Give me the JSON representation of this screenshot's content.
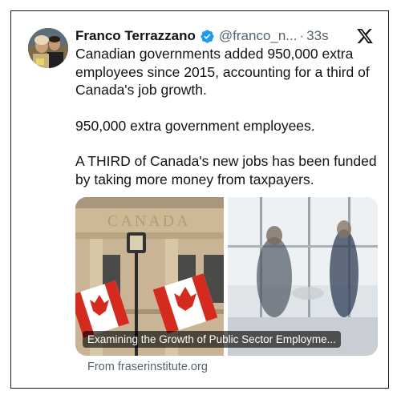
{
  "tweet": {
    "author_name": "Franco Terrazzano",
    "handle": "@franco_n...",
    "separator": "·",
    "time": "33s",
    "paragraphs": [
      "Canadian governments added 950,000 extra employees since 2015, accounting for a third of Canada's job growth.",
      "950,000 extra government employees.",
      "A THIRD of Canada's new jobs has been funded by taking more money from taxpayers."
    ]
  },
  "card": {
    "building_sign": "CANADA",
    "title": "Examining the Growth of Public Sector Employme...",
    "source": "From fraserinstitute.org"
  },
  "icons": {
    "verified": "verified-badge-icon",
    "x_logo": "x-logo-icon"
  },
  "colors": {
    "verified_blue": "#1d9bf0",
    "text": "#0f1419",
    "secondary": "#536471",
    "flag_red": "#d52b1e"
  }
}
